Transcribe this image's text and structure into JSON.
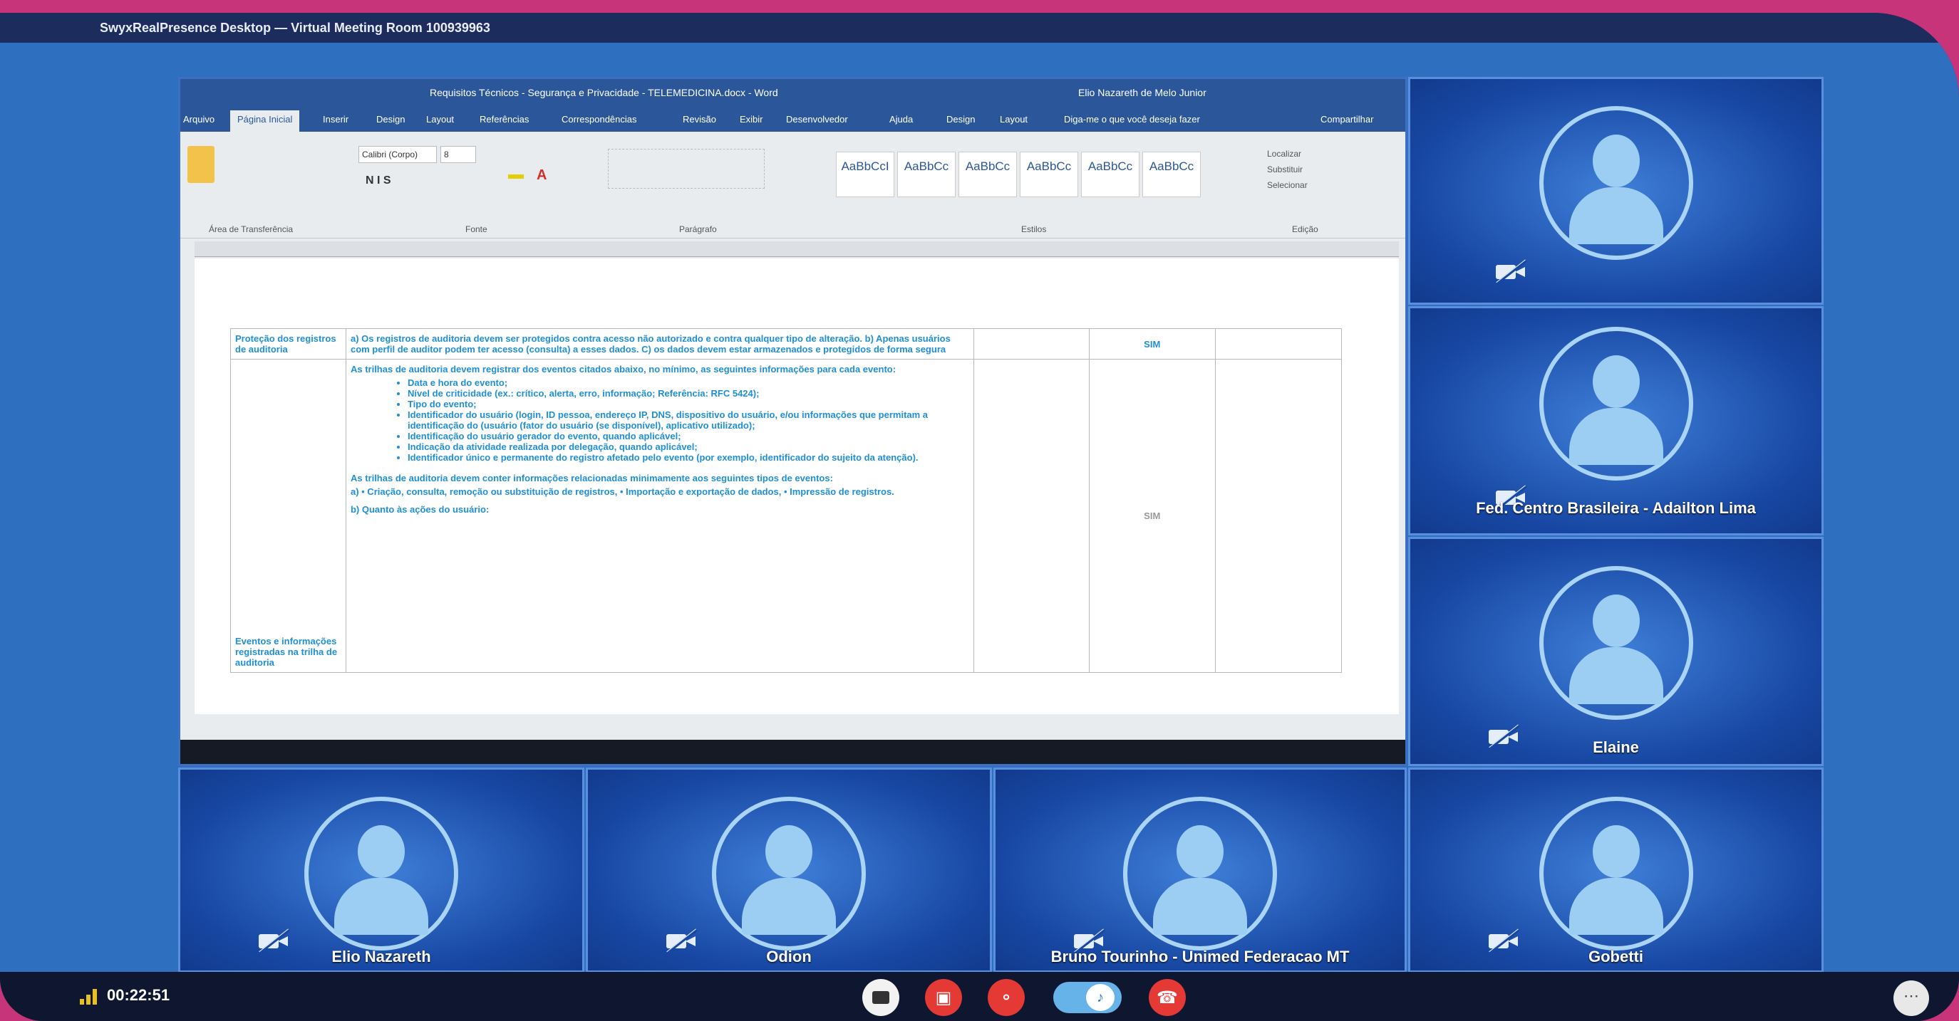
{
  "window": {
    "title": "SwyxRealPresence Desktop — Virtual Meeting Room 100939963"
  },
  "shared_screen": {
    "app_title": "Requisitos Técnicos - Segurança e Privacidade - TELEMEDICINA.docx - Word",
    "account": "Elio Nazareth de Melo Junior",
    "share_label": "Compartilhar",
    "tabs": [
      "Arquivo",
      "Página Inicial",
      "Inserir",
      "Design",
      "Layout",
      "Referências",
      "Correspondências",
      "Revisão",
      "Exibir",
      "Desenvolvedor",
      "Ajuda",
      "Design",
      "Layout",
      "Diga-me o que você deseja fazer"
    ],
    "ribbon_groups": [
      "Área de Transferência",
      "Fonte",
      "Parágrafo",
      "Estilos",
      "Edição"
    ],
    "font_name": "Calibri (Corpo)",
    "font_size": "8",
    "styles": [
      "AaBbCcI",
      "AaBbCc",
      "AaBbCc",
      "AaBbCc",
      "AaBbCc",
      "AaBbCc"
    ],
    "editing": [
      "Localizar",
      "Substituir",
      "Selecionar"
    ],
    "table": {
      "row1_label": "Proteção dos registros de auditoria",
      "row1_text": "a) Os registros de auditoria devem ser protegidos contra acesso não autorizado e contra qualquer tipo de alteração. b) Apenas usuários com perfil de auditor podem ter acesso (consulta) a esses dados. C) os dados devem estar armazenados e protegidos de forma segura",
      "row1_value": "SIM",
      "row2_intro": "As trilhas de auditoria devem registrar dos eventos citados abaixo, no mínimo, as seguintes informações para cada evento:",
      "row2_bullets": [
        "Data e hora do evento;",
        "Nível de criticidade (ex.: crítico, alerta, erro, informação; Referência: RFC 5424);",
        "Tipo do evento;",
        "Identificador do usuário (login, ID pessoa, endereço IP, DNS, dispositivo do usuário, e/ou informações que permitam a identificação do (usuário (fator do usuário (se disponível), aplicativo utilizado);",
        "Identificação do usuário gerador do evento, quando aplicável;",
        "Indicação da atividade realizada por delegação, quando aplicável;",
        "Identificador único e permanente do registro afetado pelo evento (por exemplo, identificador do sujeito da atenção)."
      ],
      "row2_more": "As trilhas de auditoria devem conter informações relacionadas minimamente aos seguintes tipos de eventos:",
      "row2_more_a": "a) • Criação, consulta, remoção ou substituição de registros, • Importação e exportação de dados, • Impressão de registros.",
      "row2_more_b": "b) Quanto às ações do usuário:",
      "row2_label": "Eventos e informações registradas na trilha de auditoria",
      "row2_value": "SIM"
    }
  },
  "participants": [
    {
      "name": ""
    },
    {
      "name": "Fed. Centro Brasileira - Adailton Lima"
    },
    {
      "name": "Elaine"
    },
    {
      "name": "Elio Nazareth"
    },
    {
      "name": "Odion"
    },
    {
      "name": "Bruno Tourinho - Unimed Federacao MT"
    },
    {
      "name": "Gobetti"
    }
  ],
  "call": {
    "duration": "00:22:51"
  },
  "colors": {
    "accent": "#2b579a",
    "end_call": "#e53935",
    "tile": "#1747a3"
  }
}
